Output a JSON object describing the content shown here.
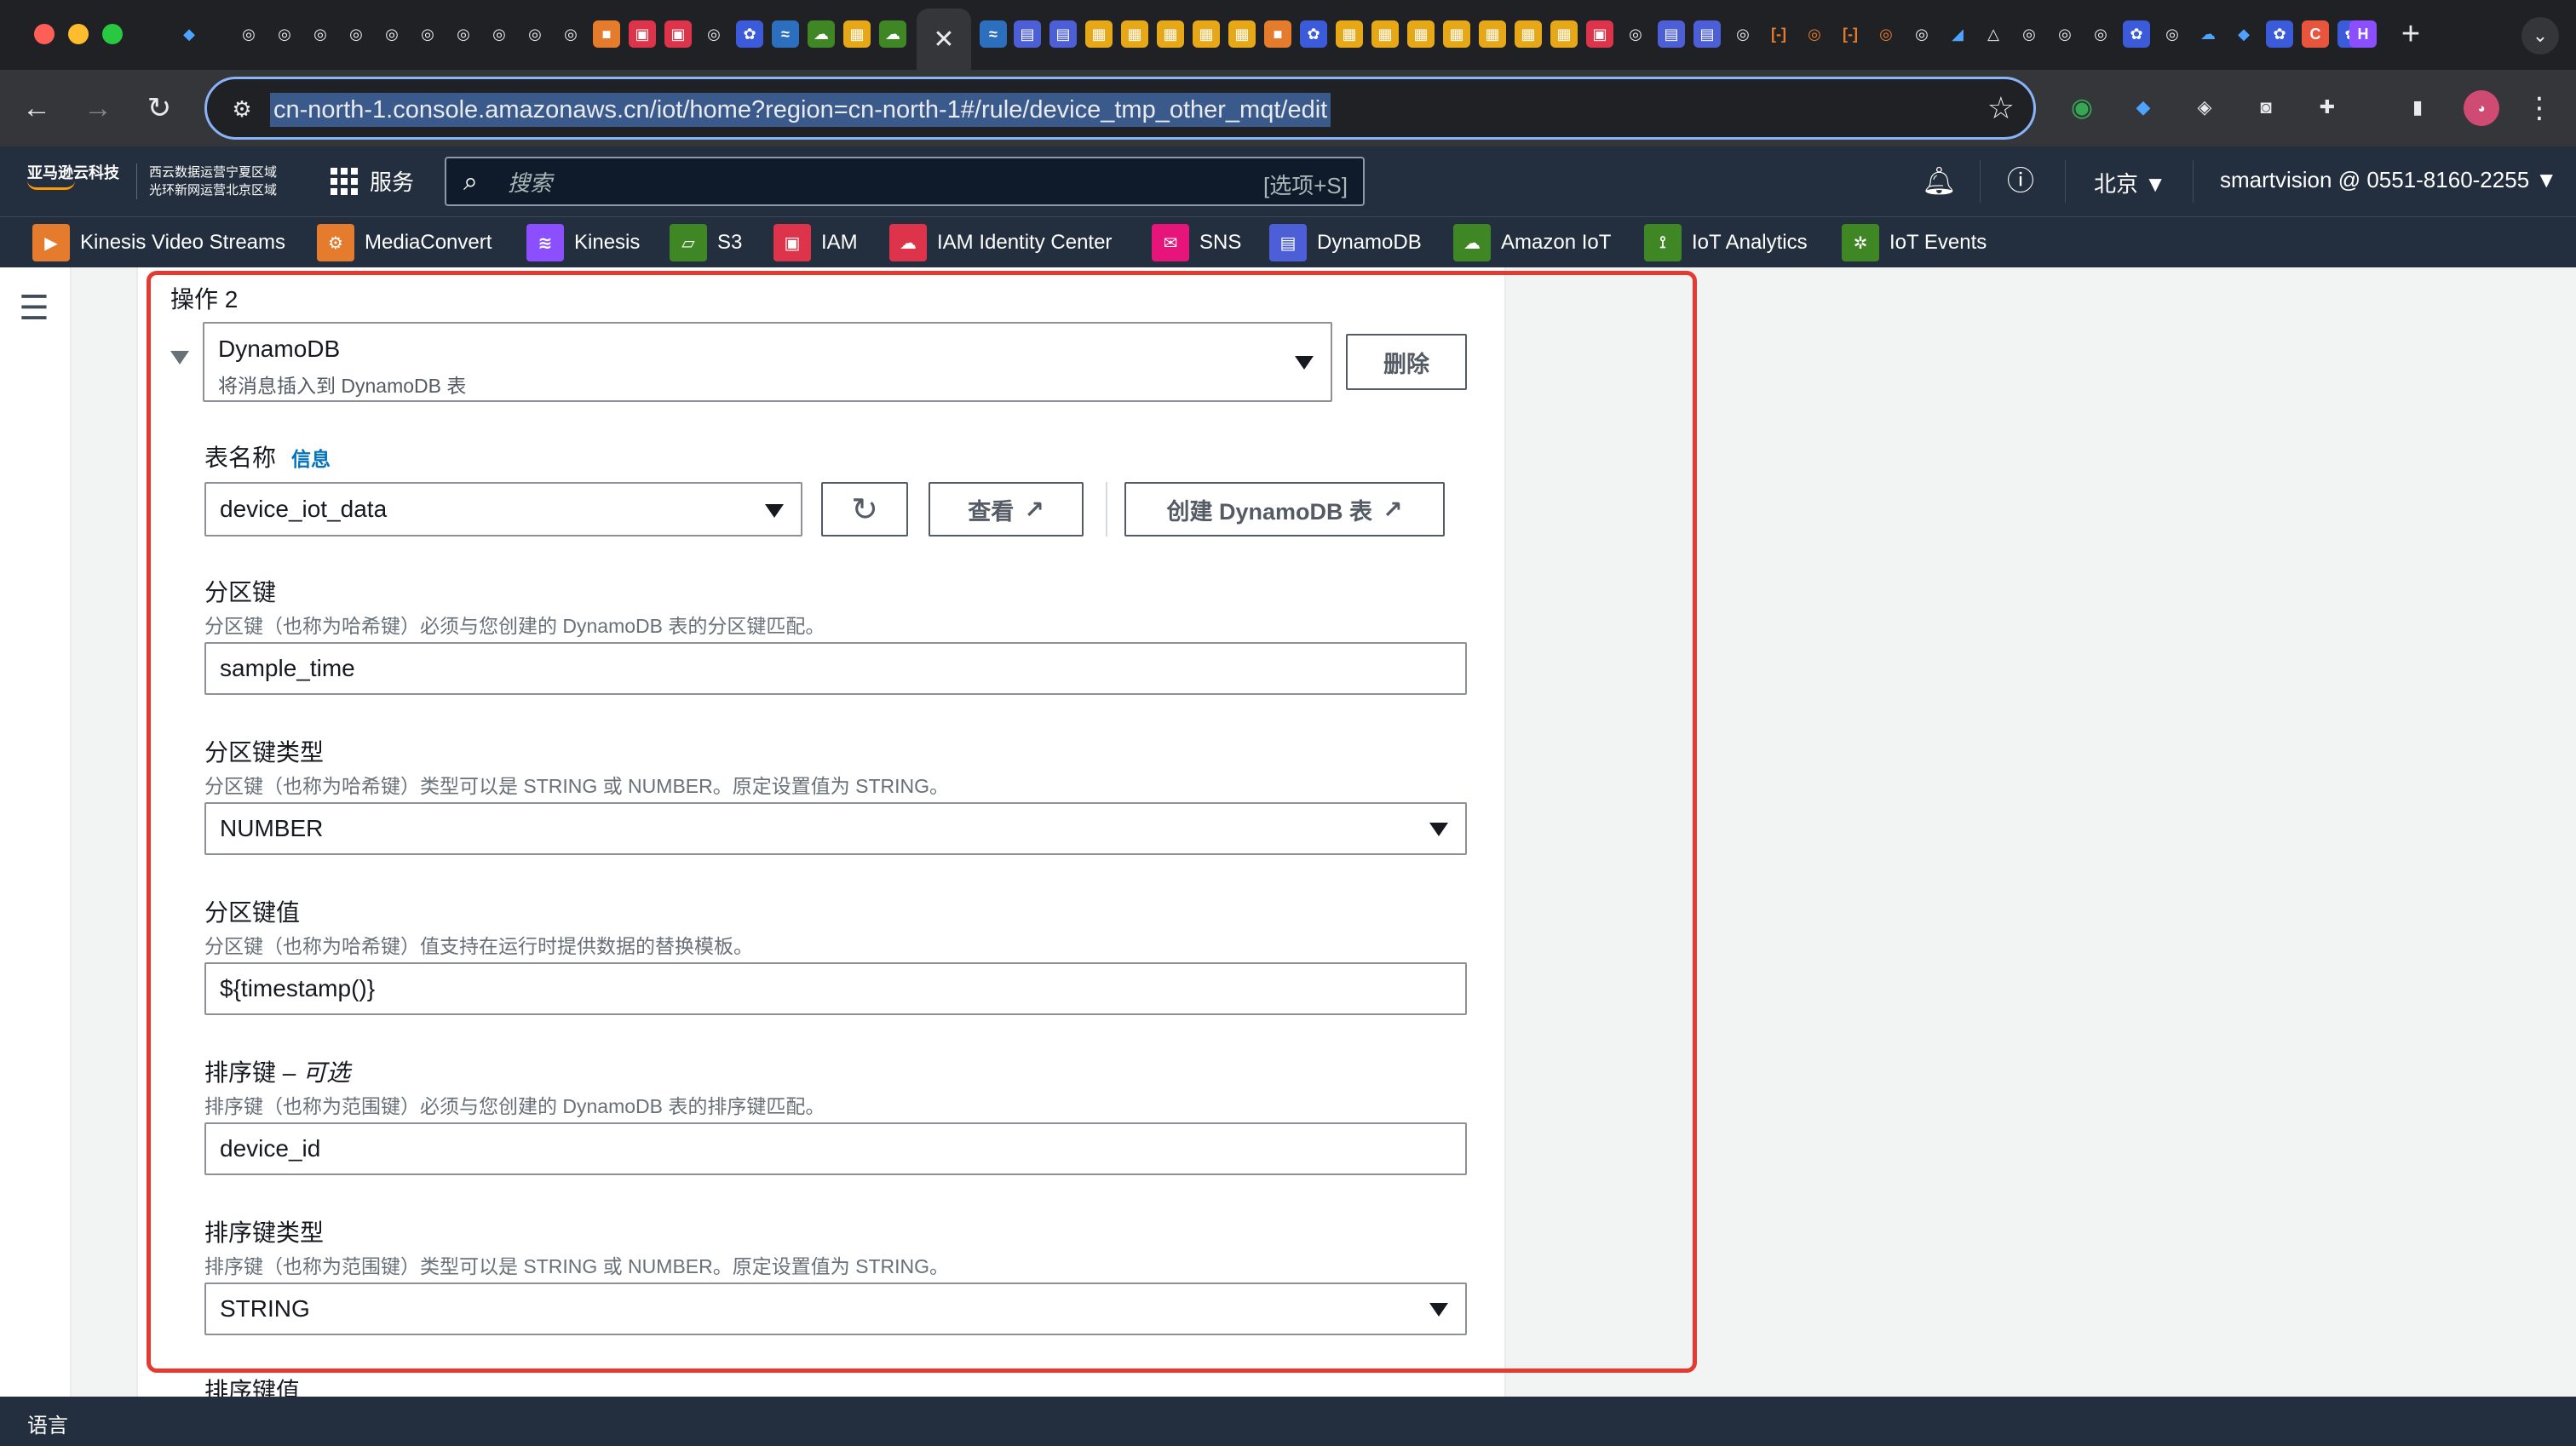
{
  "browser": {
    "url": "cn-north-1.console.amazonaws.cn/iot/home?region=cn-north-1#/rule/device_tmp_other_mqt/edit",
    "active_tab_close": "✕",
    "new_tab": "+",
    "tab_search": "⌄"
  },
  "aws_header": {
    "logo_text": "亚马逊云科技",
    "region_line1": "西云数据运营宁夏区域",
    "region_line2": "光环新网运营北京区域",
    "services_label": "服务",
    "search_placeholder": "搜索",
    "search_shortcut": "[选项+S]",
    "region": "北京 ▼",
    "account": "smartvision @ 0551-8160-2255 ▼"
  },
  "favorites": [
    {
      "label": "Kinesis Video Streams",
      "color": "#e47b2d"
    },
    {
      "label": "MediaConvert",
      "color": "#e47b2d"
    },
    {
      "label": "Kinesis",
      "color": "#8c4fff"
    },
    {
      "label": "S3",
      "color": "#3f8624"
    },
    {
      "label": "IAM",
      "color": "#dd344c"
    },
    {
      "label": "IAM Identity Center",
      "color": "#dd344c"
    },
    {
      "label": "SNS",
      "color": "#e7157b"
    },
    {
      "label": "DynamoDB",
      "color": "#4d5fd6"
    },
    {
      "label": "Amazon IoT",
      "color": "#3f8624"
    },
    {
      "label": "IoT Analytics",
      "color": "#3f8624"
    },
    {
      "label": "IoT Events",
      "color": "#3f8624"
    }
  ],
  "form": {
    "action_title": "操作 2",
    "action_select": {
      "title": "DynamoDB",
      "description": "将消息插入到 DynamoDB 表"
    },
    "delete_button": "删除",
    "table_name": {
      "label": "表名称",
      "info": "信息",
      "value": "device_iot_data",
      "view_button": "查看",
      "create_button": "创建 DynamoDB 表"
    },
    "partition_key": {
      "label": "分区键",
      "description": "分区键（也称为哈希键）必须与您创建的 DynamoDB 表的分区键匹配。",
      "value": "sample_time"
    },
    "partition_key_type": {
      "label": "分区键类型",
      "description": "分区键（也称为哈希键）类型可以是 STRING 或 NUMBER。原定设置值为 STRING。",
      "value": "NUMBER"
    },
    "partition_key_value": {
      "label": "分区键值",
      "description": "分区键（也称为哈希键）值支持在运行时提供数据的替换模板。",
      "value": "${timestamp()}"
    },
    "sort_key": {
      "label": "排序键 – ",
      "optional": "可选",
      "description": "排序键（也称为范围键）必须与您创建的 DynamoDB 表的排序键匹配。",
      "value": "device_id"
    },
    "sort_key_type": {
      "label": "排序键类型",
      "description": "排序键（也称为范围键）类型可以是 STRING 或 NUMBER。原定设置值为 STRING。",
      "value": "STRING"
    },
    "sort_key_value_label_cut": "排序键值"
  },
  "footer": {
    "language": "语言"
  },
  "colors": {
    "aws_nav": "#232f3e",
    "highlight_border": "#e53a2f",
    "link": "#0073bb"
  }
}
